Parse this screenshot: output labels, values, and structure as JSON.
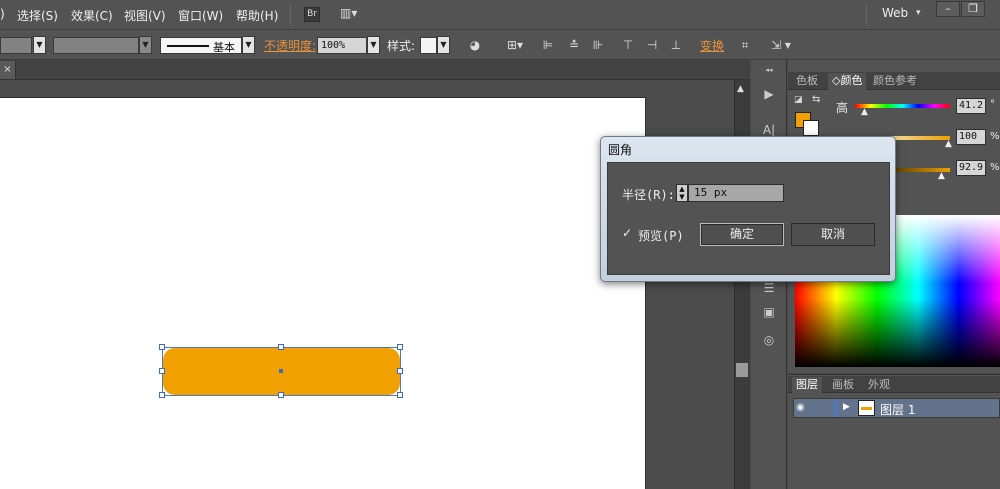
{
  "colors": {
    "shape_fill": "#f0a000",
    "accent_link": "#e8923a",
    "selection": "#4a78c8",
    "artboard": "#ffffff",
    "fill_swatch": "#f0a000",
    "slider_gold": "#e8a000"
  },
  "menubar": {
    "items": [
      "选择(S)",
      "效果(C)",
      "视图(V)",
      "窗口(W)",
      "帮助(H)"
    ],
    "bridge_button": "Br",
    "arrange_button": "▥▾",
    "workspace": "Web",
    "window_buttons": [
      "–",
      "❐"
    ]
  },
  "controlbar": {
    "stroke_profile": "基本",
    "opacity_label": "不透明度:",
    "opacity_value": "100%",
    "style_label": "样式:",
    "transform_label": "变换",
    "icons": [
      "recolor-icon",
      "align-to-icon",
      "align-left-icon",
      "align-hcenter-icon",
      "align-right-icon",
      "align-top-icon",
      "align-vcenter-icon",
      "align-bottom-icon",
      "isolate-icon",
      "envelope-icon"
    ]
  },
  "doc_tab": {
    "close": "×"
  },
  "color_panel": {
    "tabs": [
      "色板",
      "颜色",
      "颜色参考"
    ],
    "active_tab": "颜色",
    "hue_label": "高",
    "hue_value": "41.2",
    "hue_unit": "°",
    "sat_value": "100",
    "sat_unit": "%",
    "bright_value": "92.9",
    "bright_unit": "%"
  },
  "layers_panel": {
    "tabs": [
      "图层",
      "画板",
      "外观"
    ],
    "active_tab": "图层",
    "layer_name": "图层 1"
  },
  "dialog": {
    "title": "圆角",
    "radius_label": "半径(R):",
    "radius_value": "15 px",
    "preview_label": "预览(P)",
    "preview_checked": true,
    "ok_label": "确定",
    "cancel_label": "取消"
  }
}
